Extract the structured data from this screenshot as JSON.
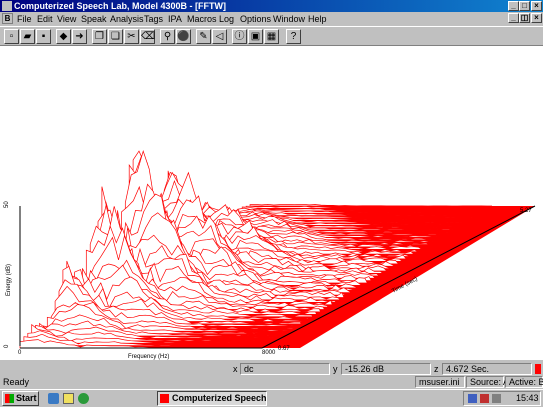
{
  "window": {
    "title": "Computerized Speech Lab, Model 4300B - [FFTW]"
  },
  "menubar": {
    "items": [
      "File",
      "Edit",
      "View",
      "Speak",
      "Analysis",
      "Tags",
      "IPA",
      "Macros",
      "Log",
      "Options",
      "Window",
      "Help"
    ]
  },
  "toolbar": {
    "buttons": [
      "new-icon",
      "open-icon",
      "save-icon",
      "back-arrow-icon",
      "forward-arrow-icon",
      "copy-icon",
      "paste-icon",
      "erase-icon",
      "record-icon",
      "play-icon",
      "pen-icon",
      "speaker-icon",
      "info-icon",
      "frame-icon",
      "grid-icon",
      "help-icon"
    ]
  },
  "plot": {
    "y_axis_label": "Energy (dB)",
    "y_max": "50",
    "y_min": "0",
    "x_axis_label": "Frequency (Hz)",
    "x_min": "0",
    "x_max": "8000",
    "x_max_time": "0.67",
    "z_axis_label": "Time (sec)",
    "z_max": "5.27",
    "colors": {
      "trace": "#ff0000",
      "background": "#ffffff"
    }
  },
  "readout": {
    "x_label": "x",
    "x_value": "dc",
    "y_label": "y",
    "y_value": "-15.26 dB",
    "z_label": "z",
    "z_value": "4.672 Sec."
  },
  "statusbar": {
    "status": "Ready",
    "ini": "msuser.ini",
    "source": "Source: A",
    "active": "Active: B"
  },
  "taskbar": {
    "start_label": "Start",
    "task_label": "Computerized Speech...",
    "time": "15:43"
  }
}
